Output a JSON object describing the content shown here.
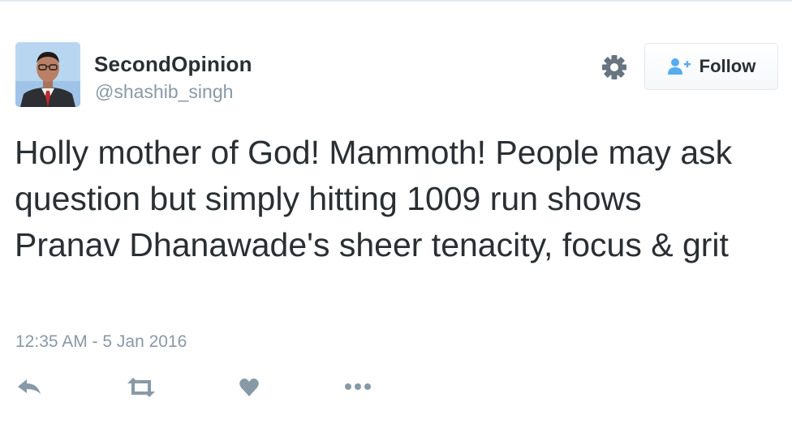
{
  "user": {
    "display_name": "SecondOpinion",
    "handle": "@shashib_singh"
  },
  "follow_button": {
    "label": "Follow"
  },
  "tweet": {
    "text": "Holly mother of God! Mammoth! People may ask question but simply hitting 1009 run shows Pranav Dhanawade's sheer tenacity, focus & grit",
    "timestamp": "12:35 AM - 5 Jan 2016"
  },
  "icons": {
    "settings": "gear-icon",
    "follow": "add-user-icon",
    "reply": "reply-icon",
    "retweet": "retweet-icon",
    "like": "heart-icon",
    "more": "more-icon"
  },
  "colors": {
    "text": "#292f33",
    "secondary_text": "#8899a6",
    "icon_gray": "#8899a6",
    "follow_icon_blue": "#55acee",
    "border": "#e1e8ed"
  }
}
